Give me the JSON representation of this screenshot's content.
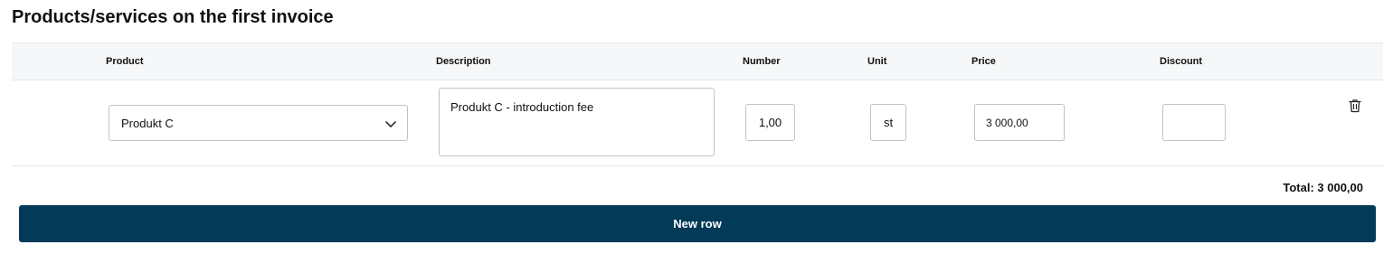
{
  "section": {
    "title": "Products/services on the first invoice"
  },
  "columns": {
    "product": "Product",
    "description": "Description",
    "number": "Number",
    "unit": "Unit",
    "price": "Price",
    "discount": "Discount"
  },
  "rows": [
    {
      "product": "Produkt C",
      "description": "Produkt C - introduction fee",
      "number": "1,00",
      "unit": "st",
      "price": "3 000,00",
      "discount": ""
    }
  ],
  "summary": {
    "total": "Total: 3 000,00"
  },
  "actions": {
    "new_row_label": "New row"
  },
  "icons": {
    "dropdown": "chevron-down-icon",
    "delete": "trash-icon"
  },
  "colors": {
    "primary_button": "#023a58",
    "header_bg": "#f6f7f8"
  }
}
